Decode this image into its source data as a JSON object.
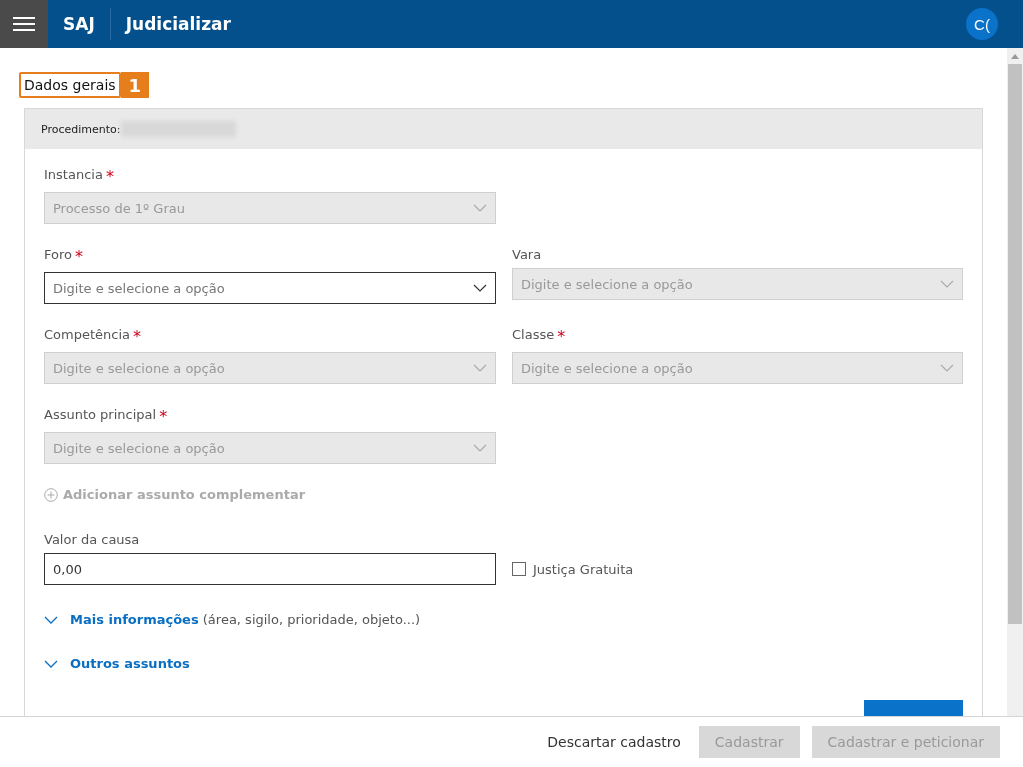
{
  "header": {
    "brand": "SAJ",
    "title": "Judicializar",
    "avatar": "C("
  },
  "section": {
    "title": "Dados gerais",
    "step": "1"
  },
  "card": {
    "procedimento_label": "Procedimento:",
    "rows": [
      [
        {
          "label": "Instancia",
          "required_mark": "*",
          "value": "Processo de 1º Grau",
          "disabled": true
        }
      ],
      [
        {
          "label": "Foro",
          "required_mark": "*",
          "placeholder": "Digite e selecione a opção",
          "disabled": false
        },
        {
          "label": "Vara",
          "placeholder": "Digite e selecione a opção",
          "disabled": true
        }
      ],
      [
        {
          "label": "Competência",
          "required_mark": "*",
          "placeholder": "Digite e selecione a opção",
          "disabled": true
        },
        {
          "label": "Classe",
          "required_mark": "*",
          "placeholder": "Digite e selecione a opção",
          "disabled": true
        }
      ],
      [
        {
          "label": "Assunto principal",
          "required_mark": "*",
          "placeholder": "Digite e selecione a opção",
          "disabled": true
        }
      ]
    ],
    "add_link": {
      "label": "Adicionar assunto complementar",
      "disabled": true
    },
    "valor": {
      "label": "Valor da causa",
      "value": "0,00"
    },
    "justica": {
      "label": "Justiça Gratuita",
      "checked": false
    },
    "expanders": [
      {
        "label": "Mais informações",
        "detail": "(área, sigilo, prioridade, objeto...)",
        "expanded": false
      },
      {
        "label": "Outros assuntos",
        "expanded": false
      }
    ]
  },
  "footer": {
    "discard": "Descartar cadastro",
    "buttons": [
      {
        "label": "Cadastrar",
        "disabled": true
      },
      {
        "label": "Cadastrar e peticionar",
        "disabled": true
      }
    ]
  }
}
